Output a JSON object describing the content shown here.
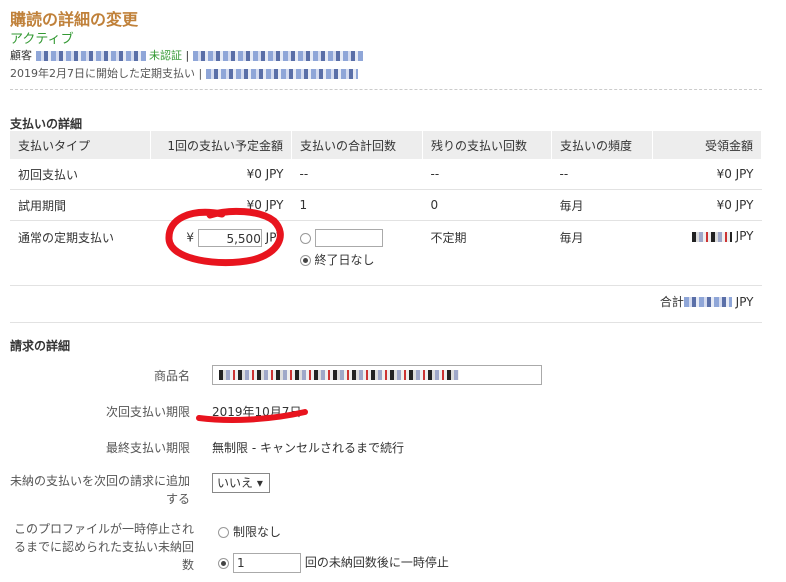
{
  "header": {
    "title": "購読の詳細の変更",
    "status": "アクティブ",
    "customer_label": "顧客",
    "unverified": "未認証",
    "separator": "|",
    "started_text": "2019年2月7日に開始した定期支払い"
  },
  "payment": {
    "section_title": "支払いの詳細",
    "columns": [
      "支払いタイプ",
      "1回の支払い予定金額",
      "支払いの合計回数",
      "残りの支払い回数",
      "支払いの頻度",
      "受領金額"
    ],
    "rows": {
      "initial": {
        "type": "初回支払い",
        "amount": "¥0 JPY",
        "total": "--",
        "remaining": "--",
        "freq": "--",
        "received": "¥0 JPY"
      },
      "trial": {
        "type": "試用期間",
        "amount": "¥0 JPY",
        "total": "1",
        "remaining": "0",
        "freq": "毎月",
        "received": "¥0 JPY"
      },
      "regular": {
        "type": "通常の定期支払い",
        "yen": "¥",
        "amount_value": "5,500",
        "currency": "JPY",
        "no_end": "終了日なし",
        "remaining": "不定期",
        "freq": "毎月",
        "received_currency": "JPY"
      }
    },
    "total_label": "合計",
    "total_currency": "JPY"
  },
  "billing": {
    "section_title": "請求の詳細",
    "product_label": "商品名",
    "next_label": "次回支払い期限",
    "next_value": "2019年10月7日",
    "last_label": "最終支払い期限",
    "last_value": "無制限 - キャンセルされるまで続行",
    "add_unpaid_label": "未納の支払いを次回の請求に追加する",
    "add_unpaid_value": "いいえ ▾",
    "suspend_label": "このプロファイルが一時停止されるまでに認められた支払い未納回数",
    "no_limit": "制限なし",
    "suspend_count": "1",
    "suspend_suffix": "回の未納回数後に一時停止"
  },
  "colors": {
    "title": "#c0813a",
    "status": "#339933",
    "marker": "#e8141e"
  }
}
